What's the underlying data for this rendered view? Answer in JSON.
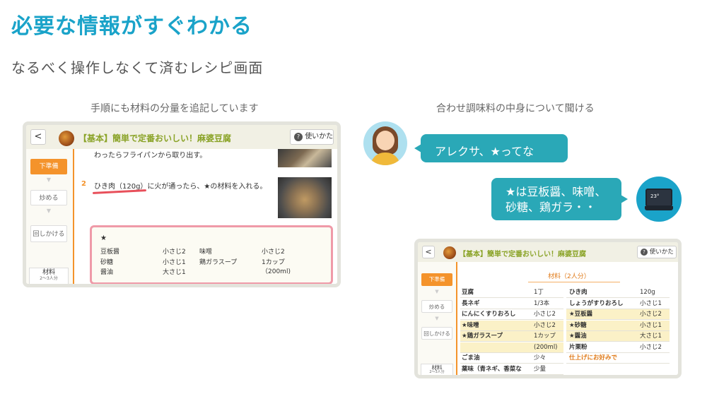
{
  "heading": "必要な情報がすぐわかる",
  "subheading": "なるべく操作しなくて済むレシピ画面",
  "captions": {
    "left": "手順にも材料の分量を追記しています",
    "right": "合わせ調味料の中身について聞ける"
  },
  "recipe": {
    "back_label": "<",
    "title": "【基本】簡単で定番おいしい！麻婆豆腐",
    "help_label": "使いかた",
    "steps": [
      "下準備",
      "炒める",
      "回しかける"
    ],
    "materials_label": "材料",
    "materials_sub": "2〜3人分"
  },
  "left_screen": {
    "line1": "わったらフライパンから取り出す。",
    "step2_num": "2",
    "step2_pre": "ひき肉（120g）",
    "step2_post": "に火が通ったら、★の材料を入れる。",
    "box": {
      "star": "★",
      "items": [
        {
          "name": "豆板醤",
          "qty": "小さじ2"
        },
        {
          "name": "味噌",
          "qty": "小さじ2"
        },
        {
          "name": "砂糖",
          "qty": "小さじ1"
        },
        {
          "name": "鶏ガラスープ",
          "qty": "1カップ"
        },
        {
          "name": "醤油",
          "qty": "大さじ1"
        },
        {
          "name": "",
          "qty": "（200ml)"
        }
      ]
    }
  },
  "chat": {
    "question": "アレクサ、★ってなに？",
    "answer_line1": "★は豆板醤、味噌、",
    "answer_line2": "砂糖、鶏ガラ・・",
    "echo_screen": "23°"
  },
  "right_screen": {
    "materials_heading": "材料（2人分）",
    "left_col": [
      {
        "name": "豆腐",
        "qty": "1丁",
        "hl": false
      },
      {
        "name": "長ネギ",
        "qty": "1/3本",
        "hl": false
      },
      {
        "name": "にんにくすりおろし",
        "qty": "小さじ2",
        "hl": false
      },
      {
        "name": "★味噌",
        "qty": "小さじ2",
        "hl": true
      },
      {
        "name": "★鶏ガラスープ",
        "qty": "1カップ",
        "hl": true
      },
      {
        "name": "",
        "qty": "(200ml)",
        "hl": true
      },
      {
        "name": "ごま油",
        "qty": "少々",
        "hl": false
      },
      {
        "name": "薬味（青ネギ、香菜な",
        "qty": "少量",
        "hl": false
      }
    ],
    "right_col": [
      {
        "name": "ひき肉",
        "qty": "120g",
        "hl": false
      },
      {
        "name": "しょうがすりおろし",
        "qty": "小さじ1",
        "hl": false
      },
      {
        "name": "★豆板醤",
        "qty": "小さじ2",
        "hl": true
      },
      {
        "name": "★砂糖",
        "qty": "小さじ1",
        "hl": true
      },
      {
        "name": "★醤油",
        "qty": "大さじ1",
        "hl": true
      },
      {
        "name": "片栗粉",
        "qty": "小さじ2",
        "hl": false
      },
      {
        "name": "仕上げにお好みで",
        "qty": "",
        "hl": false
      }
    ]
  }
}
